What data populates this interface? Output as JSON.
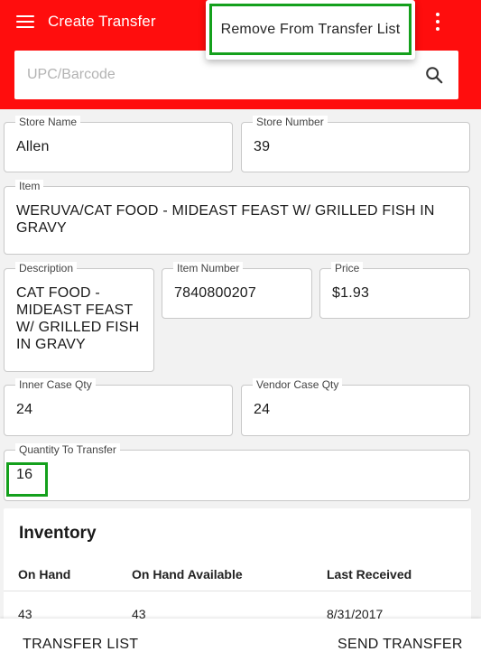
{
  "app_bar": {
    "title": "Create Transfer",
    "menu_icon": "hamburger-menu-icon",
    "more_icon": "vertical-dots-icon",
    "background": "#ff0d0d"
  },
  "overflow_menu": {
    "items": [
      {
        "label": "Remove From Transfer List"
      }
    ],
    "highlight_color": "#14a01c"
  },
  "search": {
    "placeholder": "UPC/Barcode",
    "value": "",
    "icon": "search-icon"
  },
  "form": {
    "store_name": {
      "label": "Store Name",
      "value": "Allen"
    },
    "store_number": {
      "label": "Store Number",
      "value": "39"
    },
    "item": {
      "label": "Item",
      "value": "WERUVA/CAT FOOD - MIDEAST FEAST W/ GRILLED FISH IN GRAVY"
    },
    "description": {
      "label": "Description",
      "value": "CAT FOOD - MIDEAST FEAST W/ GRILLED FISH IN GRAVY"
    },
    "item_number": {
      "label": "Item Number",
      "value": "7840800207"
    },
    "price": {
      "label": "Price",
      "value": "$1.93"
    },
    "inner_case_qty": {
      "label": "Inner Case Qty",
      "value": "24"
    },
    "vendor_case_qty": {
      "label": "Vendor Case Qty",
      "value": "24"
    },
    "quantity_to_transfer": {
      "label": "Quantity To Transfer",
      "value": "16"
    }
  },
  "inventory": {
    "title": "Inventory",
    "columns": [
      "On Hand",
      "On Hand Available",
      "Last Received"
    ],
    "rows": [
      [
        "43",
        "43",
        "8/31/2017"
      ]
    ]
  },
  "bottom_bar": {
    "transfer_list_label": "TRANSFER LIST",
    "send_transfer_label": "SEND TRANSFER"
  }
}
